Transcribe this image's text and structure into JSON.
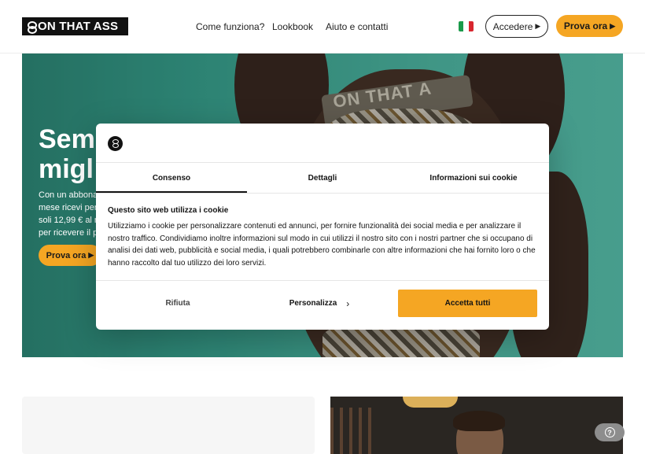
{
  "header": {
    "logo_text": "ON THAT ASS",
    "nav": [
      "Come funziona?",
      "Lookbook",
      "Aiuto e contatti"
    ],
    "language_flag": "flag-italy",
    "login_label": "Accedere",
    "try_label": "Prova ora"
  },
  "hero": {
    "title_line1": "Sem",
    "title_line2": "migl",
    "text_lines": [
      "Con un abbona",
      "mese ricevi per",
      "soli 12,99 € al m",
      "per ricevere il p"
    ],
    "cta_label": "Prova ora",
    "waistband_text": "ON THAT A"
  },
  "cookie_modal": {
    "tabs": [
      "Consenso",
      "Dettagli",
      "Informazioni sui cookie"
    ],
    "active_tab": "Consenso",
    "heading": "Questo sito web utilizza i cookie",
    "body": "Utilizziamo i cookie per personalizzare contenuti ed annunci, per fornire funzionalità dei social media e per analizzare il nostro traffico. Condividiamo inoltre informazioni sul modo in cui utilizzi il nostro sito con i nostri partner che si occupano di analisi dei dati web, pubblicità e social media, i quali potrebbero combinarle con altre informazioni che hai fornito loro o che hanno raccolto dal tuo utilizzo dei loro servizi.",
    "reject_label": "Rifiuta",
    "customize_label": "Personalizza",
    "accept_label": "Accetta tutti"
  },
  "colors": {
    "accent": "#f5a623",
    "hero_teal": "#4bb8a3",
    "dark": "#111111"
  },
  "help_icon": "question-icon"
}
